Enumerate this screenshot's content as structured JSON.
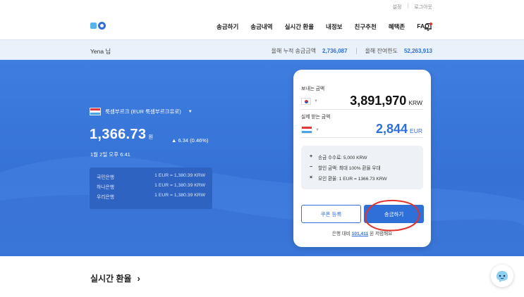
{
  "header": {
    "util_links": [
      "설정",
      "로그아웃"
    ],
    "nav": [
      "송금하기",
      "송금내역",
      "실시간 환율",
      "내정보",
      "친구추천",
      "혜택존",
      "FAQ"
    ]
  },
  "infobar": {
    "user": "Yena 님",
    "ytd_label": "올해 누적 송금금액",
    "ytd_value": "2,736,087",
    "remain_label": "올해 잔여한도",
    "remain_value": "52,263,913"
  },
  "rate_panel": {
    "currency": "룩셈부르크 (EUR 룩셈부르크유로)",
    "rate": "1,366.73",
    "rate_unit": "원",
    "change": "▲ 6.34 (0.46%)",
    "time": "1월 2일 오후 6:41",
    "banks": [
      {
        "name": "국민은행",
        "rate": "1 EUR = 1,380.39 KRW"
      },
      {
        "name": "하나은행",
        "rate": "1 EUR = 1,380.39 KRW"
      },
      {
        "name": "우리은행",
        "rate": "1 EUR = 1,380.39 KRW"
      }
    ]
  },
  "card": {
    "send_label": "보내는 금액",
    "send_amount": "3,891,970",
    "send_currency": "KRW",
    "recv_label": "실제 받는 금액",
    "recv_amount": "2,844",
    "recv_currency": "EUR",
    "fees": [
      {
        "sym": "+",
        "text": "송금 수수료: 5,000 KRW"
      },
      {
        "sym": "−",
        "text": "할인 금액: 최대 100% 환율 우대"
      },
      {
        "sym": "×",
        "text": "모인 환율: 1 EUR = 1366.73 KRW"
      }
    ],
    "coupon_label": "쿠폰 등록",
    "send_button": "송금하기",
    "savings_prefix": "은행 대비",
    "savings_value": "101,411",
    "savings_suffix": "원 저렴해요"
  },
  "section": {
    "title": "실시간 환율"
  },
  "colors": {
    "primary": "#2e6fd8",
    "hero": "#3a76dc",
    "annotation": "#e0342f"
  }
}
